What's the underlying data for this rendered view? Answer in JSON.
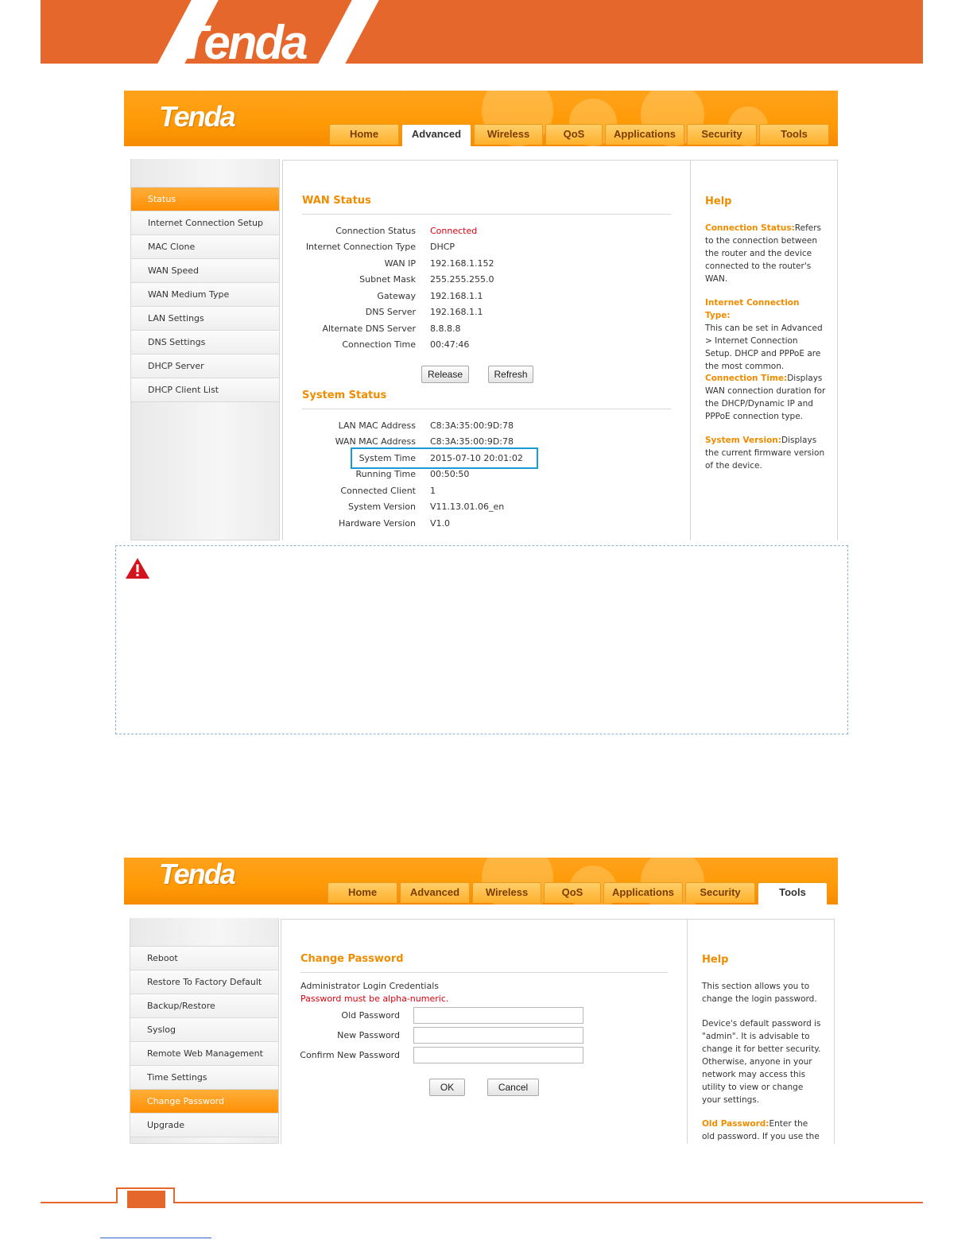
{
  "doc": {
    "brand": "Tenda"
  },
  "screen1": {
    "logo": "Tenda",
    "tabs": [
      "Home",
      "Advanced",
      "Wireless",
      "QoS",
      "Applications",
      "Security",
      "Tools"
    ],
    "active_tab": "Advanced",
    "sidebar": [
      "Status",
      "Internet Connection Setup",
      "MAC Clone",
      "WAN Speed",
      "WAN Medium Type",
      "LAN Settings",
      "DNS Settings",
      "DHCP Server",
      "DHCP Client List"
    ],
    "active_sidebar": "Status",
    "wan_title": "WAN Status",
    "wan_rows": [
      {
        "label": "Connection Status",
        "value": "Connected"
      },
      {
        "label": "Internet Connection Type",
        "value": "DHCP"
      },
      {
        "label": "WAN IP",
        "value": "192.168.1.152"
      },
      {
        "label": "Subnet Mask",
        "value": "255.255.255.0"
      },
      {
        "label": "Gateway",
        "value": "192.168.1.1"
      },
      {
        "label": "DNS Server",
        "value": "192.168.1.1"
      },
      {
        "label": "Alternate DNS Server",
        "value": "8.8.8.8"
      },
      {
        "label": "Connection Time",
        "value": "00:47:46"
      }
    ],
    "release_label": "Release",
    "refresh_label": "Refresh",
    "system_title": "System Status",
    "system_rows": [
      {
        "label": "LAN MAC Address",
        "value": "C8:3A:35:00:9D:78"
      },
      {
        "label": "WAN MAC Address",
        "value": "C8:3A:35:00:9D:78"
      },
      {
        "label": "System Time",
        "value": "2015-07-10 20:01:02"
      },
      {
        "label": "Running Time",
        "value": "00:50:50"
      },
      {
        "label": "Connected Client",
        "value": "1"
      },
      {
        "label": "System Version",
        "value": "V11.13.01.06_en"
      },
      {
        "label": "Hardware Version",
        "value": "V1.0"
      }
    ],
    "help_title": "Help",
    "help": [
      {
        "key": "Connection Status:",
        "text": "Refers to the connection between the router and the device connected to the router's WAN."
      },
      {
        "key": "Internet Connection Type:",
        "text": "This can be set in Advanced > Internet Connection Setup. DHCP and PPPoE are the most common."
      },
      {
        "key": "Connection Time:",
        "text": "Displays WAN connection duration for the DHCP/Dynamic IP and PPPoE connection type."
      },
      {
        "key": "System Version:",
        "text": "Displays the current firmware version of the device."
      }
    ]
  },
  "screen2": {
    "logo": "Tenda",
    "tabs": [
      "Home",
      "Advanced",
      "Wireless",
      "QoS",
      "Applications",
      "Security",
      "Tools"
    ],
    "active_tab": "Tools",
    "sidebar": [
      "Reboot",
      "Restore To Factory Default",
      "Backup/Restore",
      "Syslog",
      "Remote Web Management",
      "Time Settings",
      "Change Password",
      "Upgrade"
    ],
    "active_sidebar": "Change Password",
    "title": "Change Password",
    "subtitle": "Administrator Login Credentials",
    "warning": "Password must be alpha-numeric.",
    "fields": [
      {
        "label": "Old Password",
        "value": ""
      },
      {
        "label": "New Password",
        "value": ""
      },
      {
        "label": "Confirm New Password",
        "value": ""
      }
    ],
    "ok_label": "OK",
    "cancel_label": "Cancel",
    "help_title": "Help",
    "help_p1": "This section allows you to change the login password.",
    "help_p2": "Device's default password is \"admin\". It is advisable to change it for better security. Otherwise, anyone in your network may access this utility to view or change your settings.",
    "help_p3_key": "Old Password:",
    "help_p3_text": "Enter the old password. If you use the"
  },
  "colors": {
    "brand_orange": "#e5672c",
    "router_orange": "#ff9a06",
    "accent_text": "#f08c00",
    "highlight_blue": "#1a9ad6",
    "alert_red": "#d9000d"
  }
}
